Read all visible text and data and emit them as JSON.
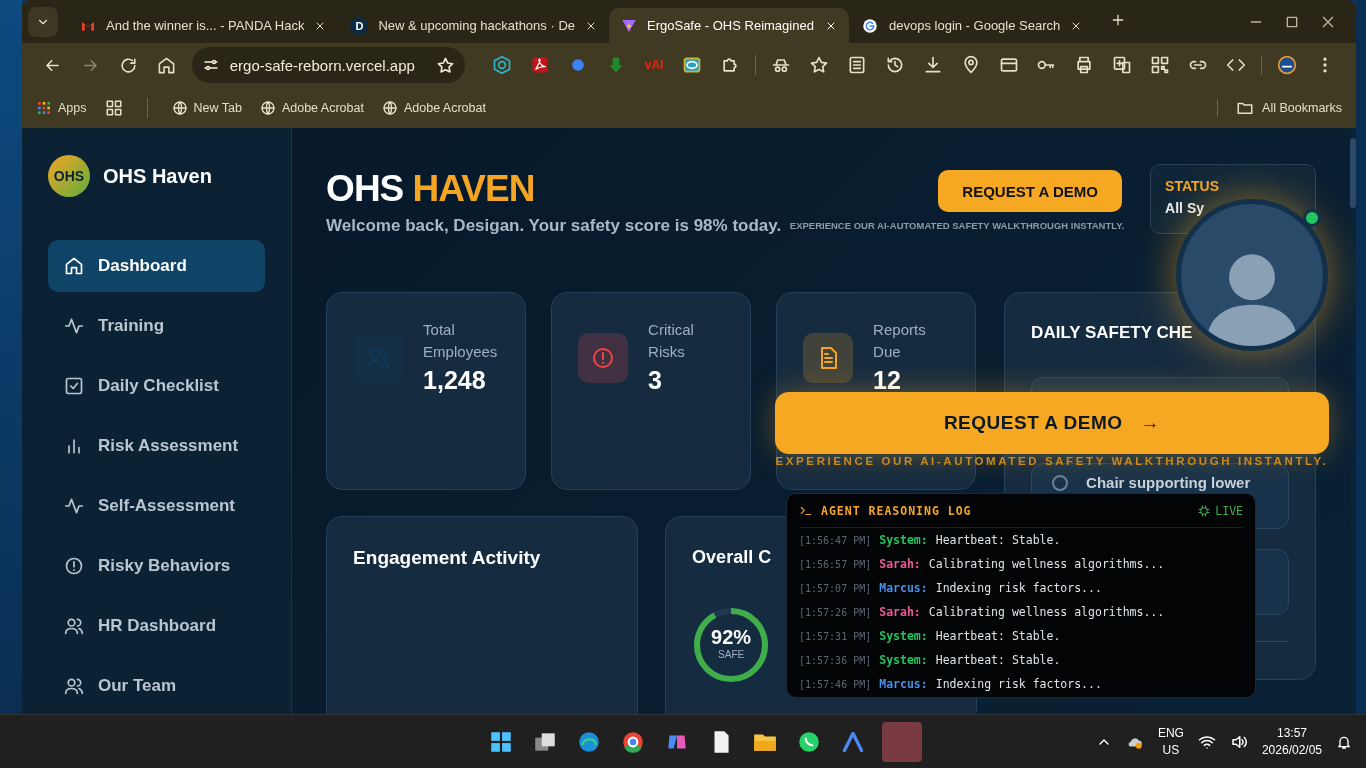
{
  "browser": {
    "tabs": [
      {
        "title": "And the winner is... - PANDA Hack",
        "kind": "mail",
        "selected": false
      },
      {
        "title": "New & upcoming hackathons · De",
        "kind": "letter",
        "badge": "D",
        "selected": false
      },
      {
        "title": "ErgoSafe - OHS Reimagined",
        "kind": "bolt",
        "selected": true
      },
      {
        "title": "devops login - Google Search",
        "kind": "google",
        "selected": false
      }
    ],
    "address": "ergo-safe-reborn.vercel.app",
    "extension_label": "vAI",
    "bookmarks": [
      {
        "label": "Apps",
        "kind": "apps"
      },
      {
        "label": "New Tab",
        "kind": "globe"
      },
      {
        "label": "Adobe Acrobat",
        "kind": "globe"
      },
      {
        "label": "Adobe Acrobat",
        "kind": "globe"
      }
    ],
    "all_bookmarks": "All Bookmarks"
  },
  "sidebar": {
    "logo": "OHS",
    "brand": "OHS Haven",
    "items": [
      {
        "label": "Dashboard",
        "kind": "home",
        "selected": true
      },
      {
        "label": "Training",
        "kind": "activity",
        "selected": false
      },
      {
        "label": "Daily Checklist",
        "kind": "check",
        "selected": false
      },
      {
        "label": "Risk Assessment",
        "kind": "chart",
        "selected": false
      },
      {
        "label": "Self-Assessment",
        "kind": "activity",
        "selected": false
      },
      {
        "label": "Risky Behaviors",
        "kind": "alert",
        "selected": false
      },
      {
        "label": "HR Dashboard",
        "kind": "users",
        "selected": false
      },
      {
        "label": "Our Team",
        "kind": "users",
        "selected": false
      }
    ]
  },
  "header": {
    "title": "OHS",
    "title_accent": "HAVEN",
    "subtitle": "Welcome back, Desigan. Your safety score is 98% today.",
    "demo_button": "REQUEST A DEMO",
    "demo_caption": "EXPERIENCE OUR AI-AUTOMATED SAFETY WALKTHROUGH INSTANTLY.",
    "status": {
      "label": "STATUS",
      "value": "All Sy"
    }
  },
  "stats": [
    {
      "label": "Total Employees",
      "value": "1,248",
      "kind": "users",
      "color": "#0e3a5c"
    },
    {
      "label": "Critical Risks",
      "value": "3",
      "kind": "alert",
      "color": "#ef4444"
    },
    {
      "label": "Reports Due",
      "value": "12",
      "kind": "file",
      "color": "#f5a524"
    }
  ],
  "checklist": {
    "title": "DAILY SAFETY CHE",
    "items": [
      {
        "label": "Chair supporting lower",
        "checked": false
      }
    ]
  },
  "engagement": {
    "title": "Engagement Activity"
  },
  "overall": {
    "title": "Overall C",
    "value": "92%",
    "caption": "SAFE",
    "level": 0.92
  },
  "demo_overlay": {
    "button": "REQUEST A DEMO",
    "arrow": "→",
    "caption": "EXPERIENCE OUR AI-AUTOMATED SAFETY WALKTHROUGH INSTANTLY."
  },
  "agent_log": {
    "title": "AGENT REASONING LOG",
    "badge": "LIVE",
    "entries": [
      {
        "time": "[1:56:47 PM]",
        "agent": "System:",
        "message": "Heartbeat: Stable.",
        "color": "#22c55e"
      },
      {
        "time": "[1:56:57 PM]",
        "agent": "Sarah:",
        "message": "Calibrating wellness algorithms...",
        "color": "#ec5a9e"
      },
      {
        "time": "[1:57:07 PM]",
        "agent": "Marcus:",
        "message": "Indexing risk factors...",
        "color": "#4a90e8"
      },
      {
        "time": "[1:57:26 PM]",
        "agent": "Sarah:",
        "message": "Calibrating wellness algorithms...",
        "color": "#ec5a9e"
      },
      {
        "time": "[1:57:31 PM]",
        "agent": "System:",
        "message": "Heartbeat: Stable.",
        "color": "#22c55e"
      },
      {
        "time": "[1:57:36 PM]",
        "agent": "System:",
        "message": "Heartbeat: Stable.",
        "color": "#22c55e"
      },
      {
        "time": "[1:57:46 PM]",
        "agent": "Marcus:",
        "message": "Indexing risk factors...",
        "color": "#4a90e8"
      }
    ]
  },
  "taskbar": {
    "language": "ENG",
    "region": "US",
    "time": "13:57",
    "date": "2026/02/05"
  }
}
